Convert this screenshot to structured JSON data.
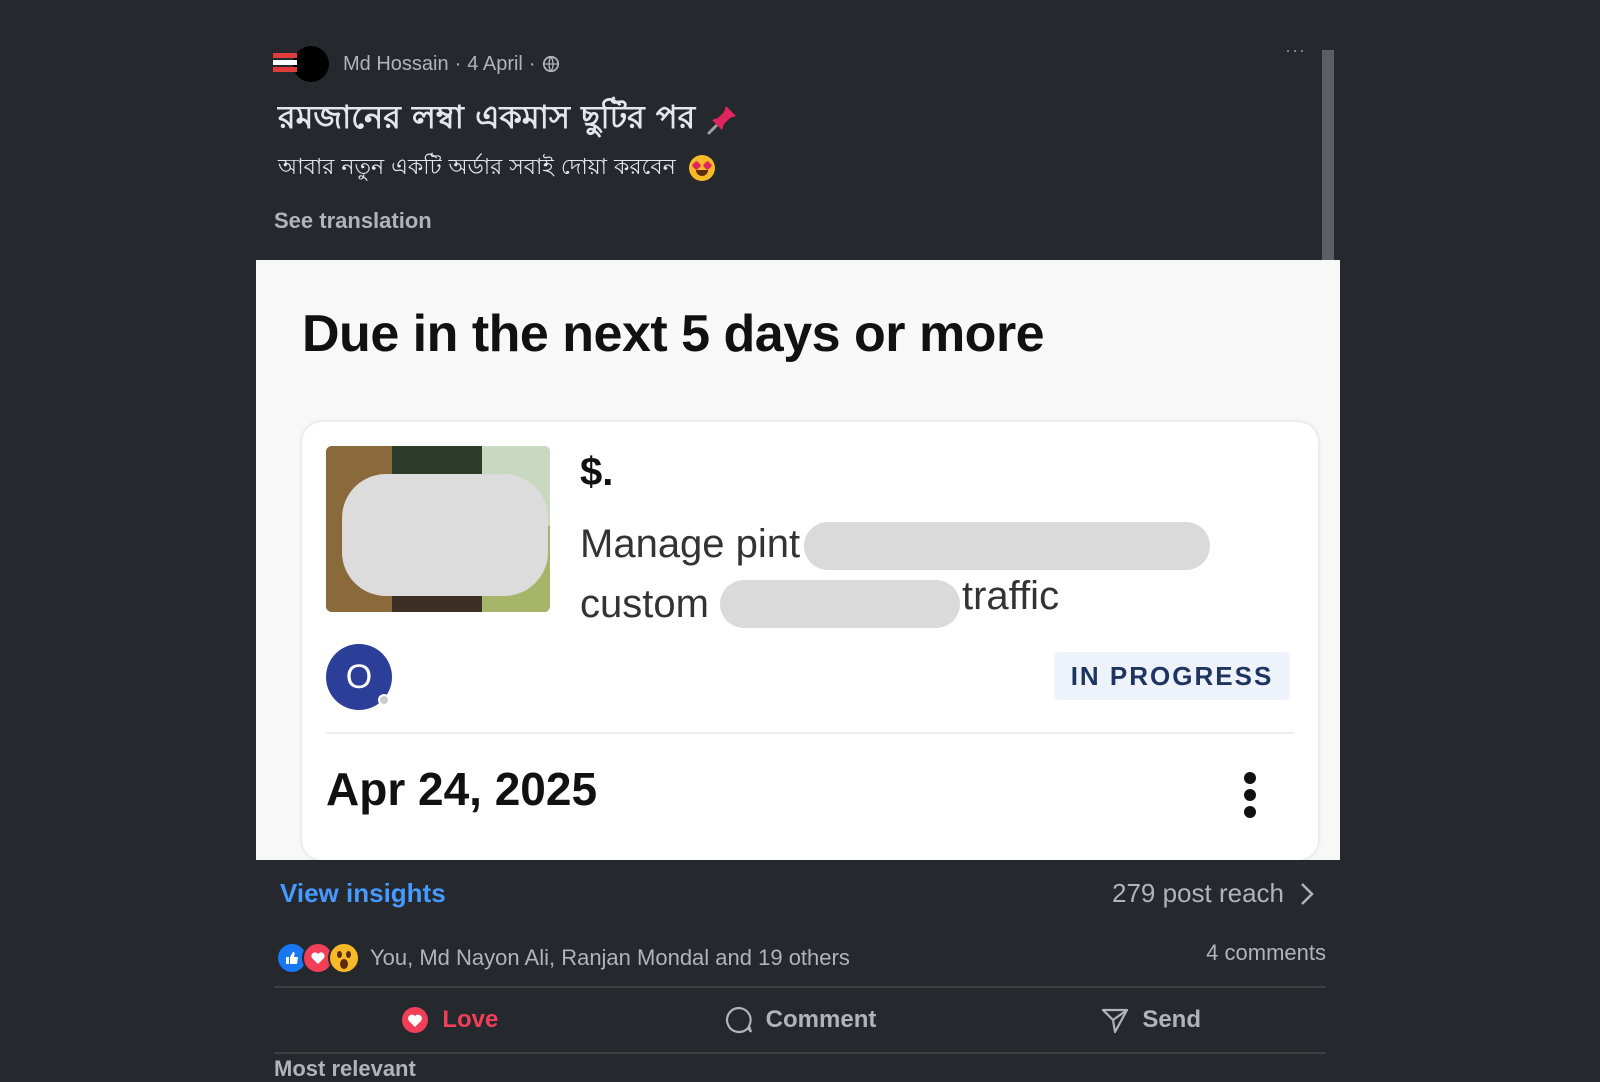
{
  "post": {
    "author": "Md Hossain",
    "date": "4 April",
    "separator": "·",
    "title": "রমজানের লম্বা একমাস ছুটির পর",
    "subtitle": "আবার নতুন একটি অর্ডার সবাই দোয়া করবেন",
    "see_translation": "See translation",
    "more_label": "···"
  },
  "screenshot": {
    "heading": "Due in the next 5 days or more",
    "price": "$.",
    "desc_line1": "Manage pint",
    "desc_line2": "custom",
    "desc_line2_end": "traffic",
    "buyer_initial": "O",
    "status": "IN PROGRESS",
    "due_date": "Apr 24, 2025"
  },
  "insights": {
    "view_label": "View insights",
    "reach": "279 post reach"
  },
  "reactions": {
    "summary": "You, Md Nayon Ali, Ranjan Mondal and 19 others",
    "comments": "4 comments"
  },
  "actions": {
    "love": "Love",
    "comment": "Comment",
    "send": "Send"
  },
  "footer": {
    "most_relevant": "Most relevant"
  },
  "colors": {
    "background": "#25282c",
    "link": "#4599ff",
    "love": "#f33e58",
    "like": "#1877f2",
    "avatar": "#2b3f98"
  }
}
